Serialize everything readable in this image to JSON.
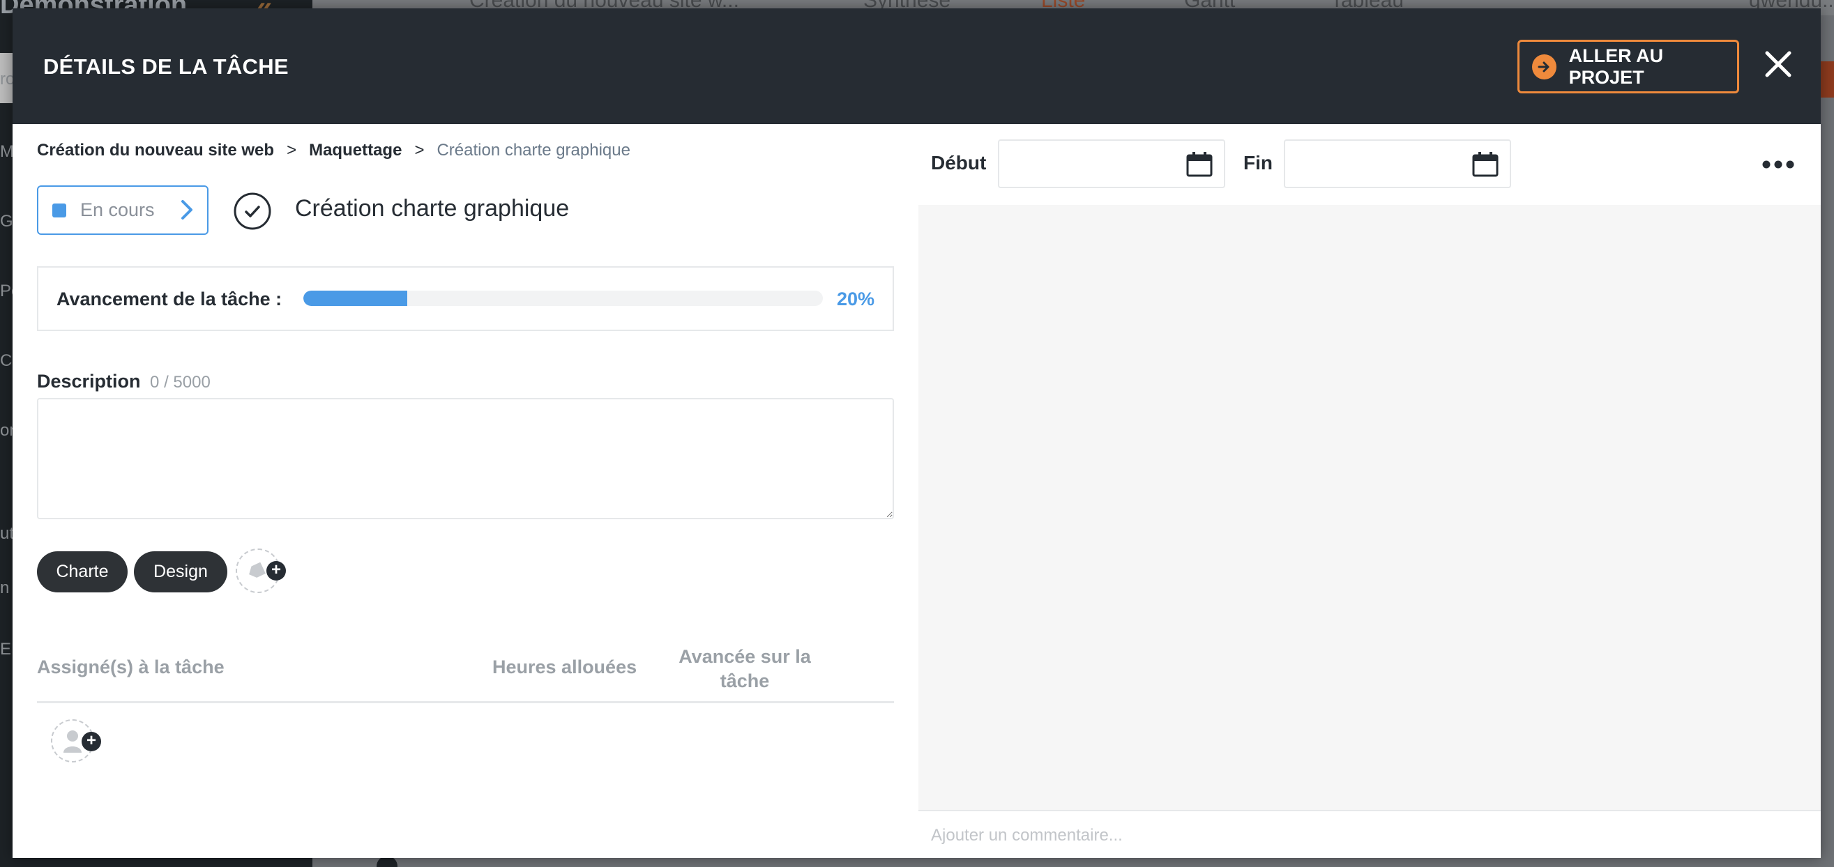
{
  "background": {
    "sidebar_title": "Démonstration",
    "left_letters": [
      "ro",
      "M",
      "G",
      "Pe",
      "Ca",
      "on",
      "ut",
      "n",
      "EM"
    ],
    "topbar": {
      "project": "Création du nouveau site w...",
      "tabs": [
        "Synthèse",
        "Liste",
        "Gantt",
        "Tableau"
      ],
      "user": "gwendu..."
    }
  },
  "modal": {
    "title": "DÉTAILS DE LA TÂCHE",
    "go_to_project_label": "ALLER AU PROJET"
  },
  "breadcrumb": [
    "Création du nouveau site web",
    "Maquettage",
    "Création charte graphique"
  ],
  "breadcrumb_separator": ">",
  "task": {
    "status": "En cours",
    "status_color": "#4a9ae6",
    "title": "Création charte graphique",
    "progress_label": "Avancement de la tâche :",
    "progress_value": 0.2,
    "progress_text": "20%"
  },
  "description": {
    "label": "Description",
    "count": "0 / 5000",
    "value": ""
  },
  "tags": [
    "Charte",
    "Design"
  ],
  "assignees_table": {
    "columns": [
      "Assigné(s) à la tâche",
      "Heures allouées",
      "Avancée sur la tâche"
    ],
    "rows": []
  },
  "dates": {
    "start_label": "Début",
    "start_value": "",
    "end_label": "Fin",
    "end_value": ""
  },
  "comments": {
    "placeholder": "Ajouter un commentaire..."
  },
  "colors": {
    "header_bg": "#262c33",
    "accent_orange": "#ef8a3c",
    "accent_blue": "#4a9ae6"
  }
}
